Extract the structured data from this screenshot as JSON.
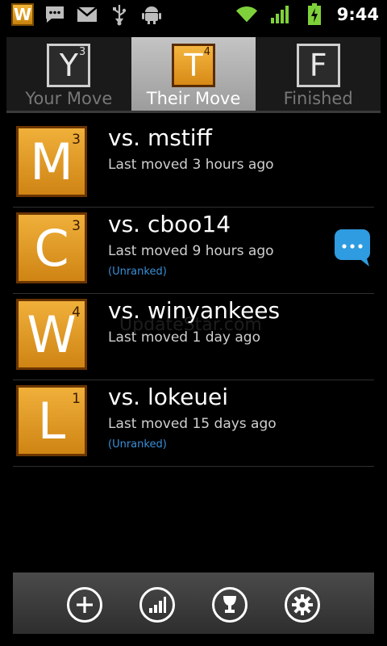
{
  "statusbar": {
    "app_tile_letter": "W",
    "left_icons": [
      "message-icon",
      "gmail-icon",
      "usb-icon",
      "android-debug-icon"
    ],
    "right_icons": [
      "wifi-icon",
      "signal-icon",
      "battery-charging-icon"
    ],
    "time": "9:44"
  },
  "tabs": [
    {
      "letter": "Y",
      "count": "3",
      "label": "Your Move",
      "active": false
    },
    {
      "letter": "T",
      "count": "4",
      "label": "Their Move",
      "active": true
    },
    {
      "letter": "F",
      "count": "",
      "label": "Finished",
      "active": false
    }
  ],
  "games": [
    {
      "letter": "M",
      "count": "3",
      "opponent": "vs. mstiff",
      "last_moved": "Last moved 3 hours ago",
      "tag": "",
      "has_chat": false
    },
    {
      "letter": "C",
      "count": "3",
      "opponent": "vs. cboo14",
      "last_moved": "Last moved 9 hours ago",
      "tag": "(Unranked)",
      "has_chat": true
    },
    {
      "letter": "W",
      "count": "4",
      "opponent": "vs. winyankees",
      "last_moved": "Last moved 1 day ago",
      "tag": "",
      "has_chat": false
    },
    {
      "letter": "L",
      "count": "1",
      "opponent": "vs. lokeuei",
      "last_moved": "Last moved 15 days ago",
      "tag": "(Unranked)",
      "has_chat": false
    }
  ],
  "watermark": "UpdateStar.com",
  "bottombar": {
    "buttons": [
      "new-game-icon",
      "stats-icon",
      "trophy-icon",
      "settings-icon"
    ]
  },
  "colors": {
    "tile_orange": "#e09a22",
    "link_blue": "#3a8fd8",
    "chat_blue": "#2f9be0"
  }
}
